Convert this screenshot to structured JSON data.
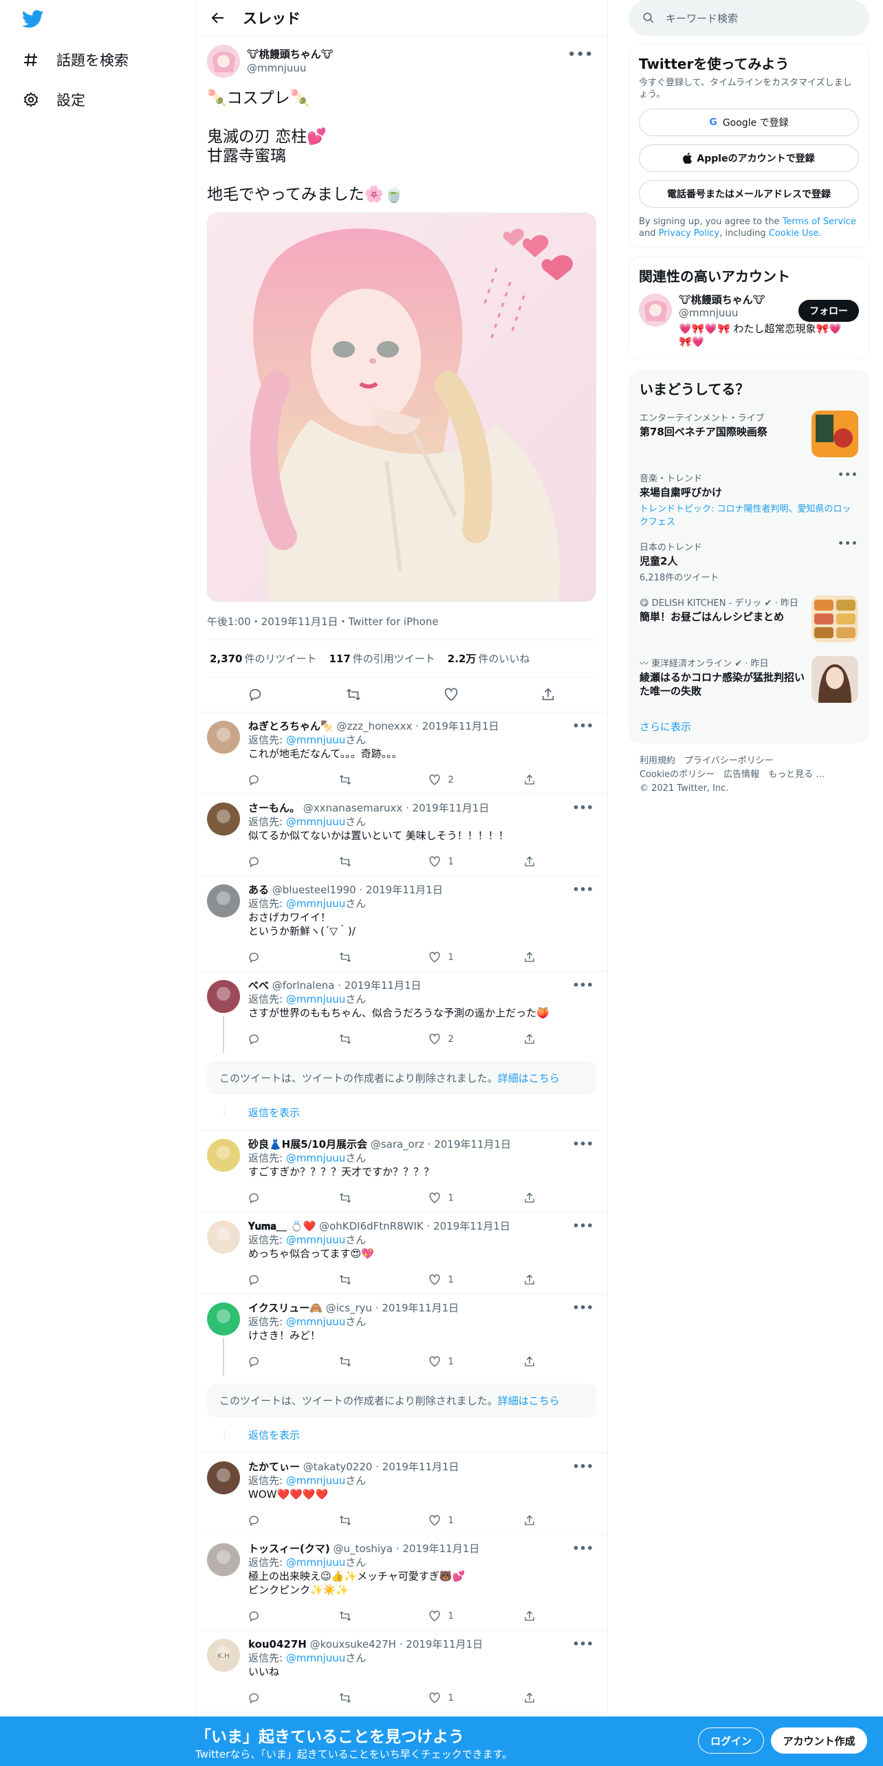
{
  "nav": {
    "search_label": "話題を検索",
    "settings_label": "設定"
  },
  "header": {
    "title": "スレッド"
  },
  "post": {
    "name": "🐮桃饅頭ちゃん🐮",
    "handle": "@mmnjuuu",
    "text": "🍡コスプレ🍡\n\n鬼滅の刃 恋柱💕\n甘露寺蜜璃\n\n地毛でやってみました🌸🍵",
    "meta": "午後1:00・2019年11月1日・Twitter for iPhone",
    "retweets": "2,370",
    "retweets_label": "件のリツイート",
    "quotes": "117",
    "quotes_label": "件の引用ツイート",
    "likes": "2.2万",
    "likes_label": "件のいいね"
  },
  "reply_to_label": "返信先:",
  "reply_mention": "@mmnjuuu",
  "reply_suffix": "さん",
  "deleted_text": "このツイートは、ツイートの作成者により削除されました。",
  "deleted_link": "詳細はこちら",
  "show_replies": "返信を表示",
  "replies": [
    {
      "name": "ねぎとろちゃん🍢",
      "handle": "@zzz_honexxx",
      "date": "2019年11月1日",
      "text": "これが地毛だなんて。。。奇跡。。。",
      "likes": "2",
      "av": "#c9a68a"
    },
    {
      "name": "さーもん。",
      "handle": "@xxnanasemaruxx",
      "date": "2019年11月1日",
      "text": "似てるか似てないかは置いといて 美味しそう！！！！！",
      "likes": "1",
      "av": "#7a5b3d"
    },
    {
      "name": "ある",
      "handle": "@bluesteel1990",
      "date": "2019年11月1日",
      "text": "おさげカワイイ！\nというか新鮮ヽ(´▽｀)/",
      "likes": "1",
      "av": "#8b8f94"
    },
    {
      "name": "べべ",
      "handle": "@forlnalena",
      "date": "2019年11月1日",
      "text": "さすが世界のももちゃん、似合うだろうな予測の遥か上だった🍑",
      "likes": "2",
      "av": "#9c4a58"
    },
    {
      "name": "砂良👗H展5/10月展示会",
      "handle": "@sara_orz",
      "date": "2019年11月1日",
      "text": "すごすぎか？？？？天才ですか？？？？",
      "likes": "1",
      "av": "#e6d27a"
    },
    {
      "name": "𝐘𝐮𝐦𝐚＿ 💍❤️",
      "handle": "@ohKDI6dFtnR8WIK",
      "date": "2019年11月1日",
      "text": "めっちゃ似合ってます😍💖",
      "likes": "1",
      "av": "#f1e1d0"
    },
    {
      "name": "イクスリュー🙈",
      "handle": "@ics_ryu",
      "date": "2019年11月1日",
      "text": "けさき！みど！",
      "likes": "1",
      "av": "#2fbf71"
    },
    {
      "name": "たかてぃー",
      "handle": "@takaty0220",
      "date": "2019年11月1日",
      "text": "WOW❤️❤️❤️❤️",
      "likes": "1",
      "av": "#6b4a3a"
    },
    {
      "name": "トッスィー(クマ)",
      "handle": "@u_toshiya",
      "date": "2019年11月1日",
      "text": "極上の出来映え😉👍✨メッチャ可愛すぎ🐻💕\nピンクピンク✨☀️✨",
      "likes": "1",
      "av": "#b7b0ad"
    },
    {
      "name": "kou0427H",
      "handle": "@kouxsuke427H",
      "date": "2019年11月1日",
      "text": "いいね",
      "likes": "1",
      "av": "#e8dccb",
      "av_text": "K.H"
    }
  ],
  "right": {
    "search_placeholder": "キーワード検索",
    "signup_title": "Twitterを使ってみよう",
    "signup_sub": "今すぐ登録して、タイムラインをカスタマイズしましょう。",
    "google_btn": "Google で登録",
    "apple_btn": "Appleのアカウントで登録",
    "phone_btn": "電話番号またはメールアドレスで登録",
    "legal_a": "By signing up, you agree to the",
    "legal_tos": "Terms of Service",
    "legal_and": "and",
    "legal_privacy": "Privacy Policy",
    "legal_incl": ", including",
    "legal_cookie": "Cookie Use.",
    "related_title": "関連性の高いアカウント",
    "related_name": "🐮桃饅頭ちゃん🐮",
    "related_handle": "@mmnjuuu",
    "related_bio": "💗🎀💗🎀 わたし超常恋現象🎀💗🎀💗",
    "follow_btn": "フォロー",
    "trends_title": "いまどうしてる？",
    "trends": [
      {
        "cat": "エンターテインメント・ライブ",
        "title": "第78回ベネチア国際映画祭",
        "sub": ""
      },
      {
        "cat": "音楽・トレンド",
        "title": "来場自粛呼びかけ",
        "sub": "トレンドトピック: コロナ陽性者判明、愛知県のロックフェス"
      },
      {
        "cat": "日本のトレンド",
        "title": "児童2人",
        "sub": "6,218件のツイート"
      },
      {
        "cat": "😋 DELISH KITCHEN - デリッ ✔ · 昨日",
        "title": "簡単！お昼ごはんレシピまとめ",
        "sub": ""
      },
      {
        "cat": "〰 東洋経済オンライン ✔ · 昨日",
        "title": "綾瀬はるかコロナ感染が猛批判招いた唯一の失敗",
        "sub": ""
      }
    ],
    "show_more": "さらに表示",
    "footer1": "利用規約　プライバシーポリシー",
    "footer2": "Cookieのポリシー　広告情報　もっと見る …",
    "footer3": "© 2021 Twitter, Inc."
  },
  "bottom": {
    "title": "「いま」起きていることを見つけよう",
    "sub": "Twitterなら、「いま」起きていることをいち早くチェックできます。",
    "login": "ログイン",
    "signup": "アカウント作成"
  }
}
